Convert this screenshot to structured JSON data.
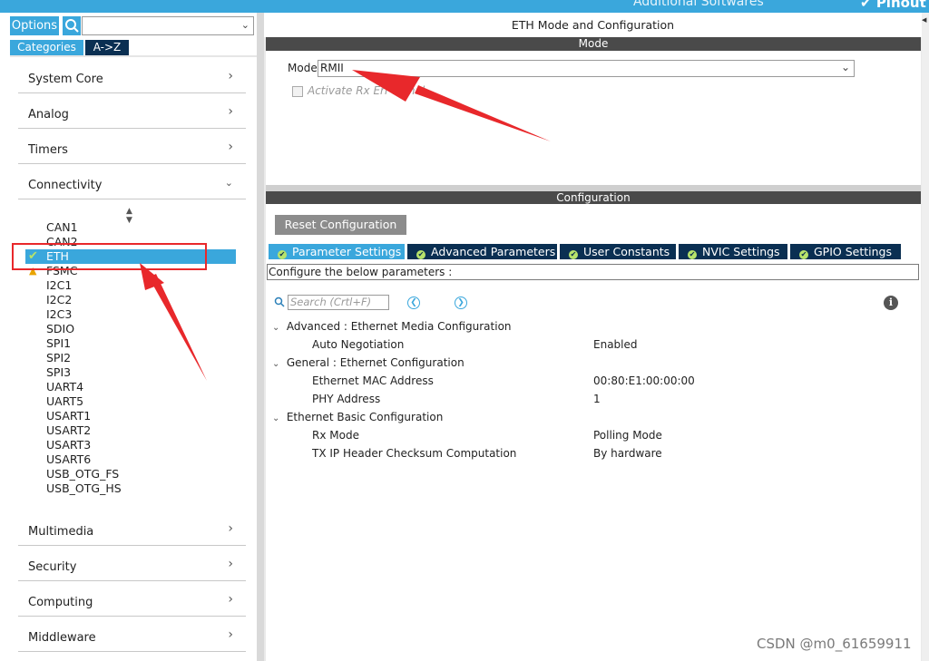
{
  "topbar": {
    "additional_softwares": "Additional Softwares",
    "pinout": "Pinout"
  },
  "left": {
    "options_label": "Options",
    "search_value": "",
    "categories_label": "Categories",
    "az_label": "A->Z",
    "categories": {
      "system_core": "System Core",
      "analog": "Analog",
      "timers": "Timers",
      "connectivity": "Connectivity",
      "multimedia": "Multimedia",
      "security": "Security",
      "computing": "Computing",
      "middleware": "Middleware"
    },
    "connectivity_items": [
      "CAN1",
      "CAN2",
      "ETH",
      "FSMC",
      "I2C1",
      "I2C2",
      "I2C3",
      "SDIO",
      "SPI1",
      "SPI2",
      "SPI3",
      "UART4",
      "UART5",
      "USART1",
      "USART2",
      "USART3",
      "USART6",
      "USB_OTG_FS",
      "USB_OTG_HS"
    ]
  },
  "right": {
    "title": "ETH Mode and Configuration",
    "mode_header": "Mode",
    "mode_label": "Mode",
    "mode_value": "RMII",
    "rx_err_label": "Activate Rx Err signal",
    "config_header": "Configuration",
    "reset_button": "Reset Configuration",
    "tabs": [
      "Parameter Settings",
      "Advanced Parameters",
      "User Constants",
      "NVIC Settings",
      "GPIO Settings"
    ],
    "configure_text": "Configure the below parameters :",
    "search_placeholder": "Search (Crtl+F)",
    "groups": {
      "g1": "Advanced : Ethernet Media Configuration",
      "g2": "General : Ethernet Configuration",
      "g3": "Ethernet Basic Configuration"
    },
    "params": {
      "auto_neg_name": "Auto Negotiation",
      "auto_neg_value": "Enabled",
      "mac_name": "Ethernet MAC Address",
      "mac_value": "00:80:E1:00:00:00",
      "phy_name": "PHY Address",
      "phy_value": "1",
      "rx_mode_name": "Rx Mode",
      "rx_mode_value": "Polling Mode",
      "txip_name": "TX IP Header Checksum Computation",
      "txip_value": "By hardware"
    }
  },
  "watermark": "CSDN @m0_61659911",
  "colors": {
    "accent": "#3aa7dc",
    "dark": "#0a2f52",
    "annotation": "#e8282b"
  }
}
